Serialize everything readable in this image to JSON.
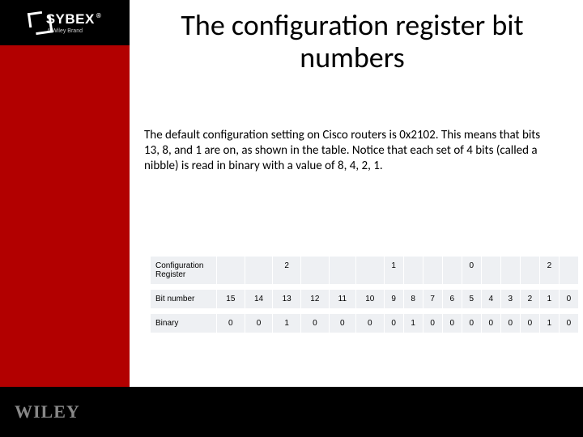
{
  "logo": {
    "sybex": "SYBEX",
    "sybex_sub": "A Wiley Brand",
    "wiley": "WILEY"
  },
  "title": "The configuration register bit numbers",
  "paragraph": "The default configuration setting on Cisco routers is 0x2102. This means that bits 13, 8, and 1 are on, as shown in the table. Notice that each set of 4 bits (called a nibble) is read in binary with a value of 8, 4, 2, 1.",
  "table": {
    "rows": [
      {
        "label": "Configuration Register",
        "vals": [
          "",
          "",
          "2",
          "",
          "",
          "",
          "1",
          "",
          "",
          "",
          "0",
          "",
          "",
          "",
          "2",
          ""
        ]
      },
      {
        "label": "Bit number",
        "vals": [
          "15",
          "14",
          "13",
          "12",
          "11",
          "10",
          "9",
          "8",
          "7",
          "6",
          "5",
          "4",
          "3",
          "2",
          "1",
          "0"
        ]
      },
      {
        "label": "Binary",
        "vals": [
          "0",
          "0",
          "1",
          "0",
          "0",
          "0",
          "0",
          "1",
          "0",
          "0",
          "0",
          "0",
          "0",
          "0",
          "1",
          "0"
        ]
      }
    ]
  },
  "chart_data": {
    "type": "table",
    "title": "The configuration register bit numbers",
    "columns": [
      "Bit number",
      "Binary",
      "Configuration Register nibble hex"
    ],
    "rows": [
      [
        15,
        0,
        "2"
      ],
      [
        14,
        0,
        "2"
      ],
      [
        13,
        1,
        "2"
      ],
      [
        12,
        0,
        "2"
      ],
      [
        11,
        0,
        "1"
      ],
      [
        10,
        0,
        "1"
      ],
      [
        9,
        0,
        "1"
      ],
      [
        8,
        1,
        "1"
      ],
      [
        7,
        0,
        "0"
      ],
      [
        6,
        0,
        "0"
      ],
      [
        5,
        0,
        "0"
      ],
      [
        4,
        0,
        "0"
      ],
      [
        3,
        0,
        "2"
      ],
      [
        2,
        0,
        "2"
      ],
      [
        1,
        1,
        "2"
      ],
      [
        0,
        0,
        "2"
      ]
    ]
  }
}
